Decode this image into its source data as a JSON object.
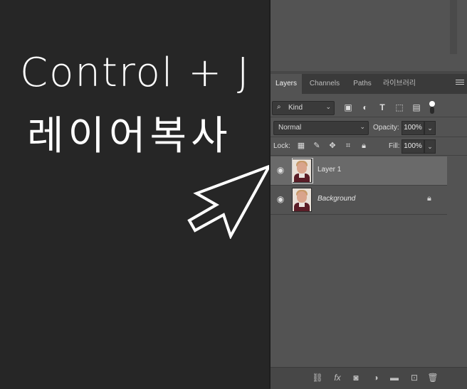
{
  "caption": {
    "line1": "Control + J",
    "line2": "레이어복사"
  },
  "panel": {
    "tabs": [
      {
        "label": "Layers",
        "active": true
      },
      {
        "label": "Channels",
        "active": false
      },
      {
        "label": "Paths",
        "active": false
      },
      {
        "label": "라이브러리",
        "active": false
      }
    ],
    "filter": {
      "kind_label": "Kind"
    },
    "blend_mode": "Normal",
    "opacity_label": "Opacity:",
    "opacity_value": "100%",
    "lock_label": "Lock:",
    "fill_label": "Fill:",
    "fill_value": "100%",
    "layers": [
      {
        "name": "Layer 1",
        "selected": true,
        "visible": true,
        "locked": false
      },
      {
        "name": "Background",
        "selected": false,
        "visible": true,
        "locked": true
      }
    ]
  },
  "colors": {
    "canvas_bg": "#262626",
    "panel_bg": "#535353",
    "selected_row": "#6a6a6a",
    "text": "#e6e6e6"
  }
}
